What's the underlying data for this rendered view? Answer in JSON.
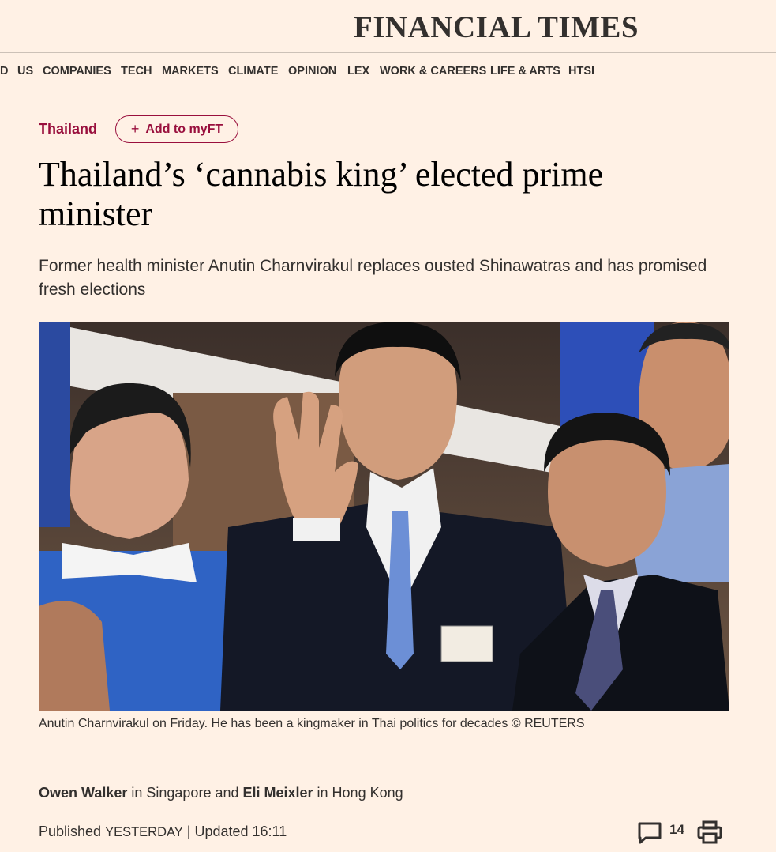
{
  "masthead": {
    "logo": "FINANCIAL TIMES"
  },
  "nav": {
    "items": [
      "D",
      "US",
      "COMPANIES",
      "TECH",
      "MARKETS",
      "CLIMATE",
      "OPINION",
      "LEX",
      "WORK & CAREERS",
      "LIFE & ARTS",
      "HTSI"
    ]
  },
  "article": {
    "topic": "Thailand",
    "follow_label": "Add to myFT",
    "follow_icon": "plus-icon",
    "headline": "Thailand’s ‘cannabis king’ elected prime minister",
    "standfirst": "Former health minister Anutin Charnvirakul replaces ousted Shinawatras and has promised fresh elections",
    "caption": "Anutin Charnvirakul on Friday. He has been a kingmaker in Thai politics for decades © REUTERS",
    "byline": {
      "author1": "Owen Walker",
      "location1": " in Singapore and ",
      "author2": "Eli Meixler",
      "location2": " in Hong Kong"
    },
    "published": {
      "label": "Published ",
      "published_time": "YESTERDAY",
      "separator": " | ",
      "updated_label": "Updated ",
      "updated_time": "16:11"
    },
    "comments_count": "14"
  },
  "colors": {
    "background": "#fff1e5",
    "accent": "#990f3d",
    "text": "#33302e"
  }
}
